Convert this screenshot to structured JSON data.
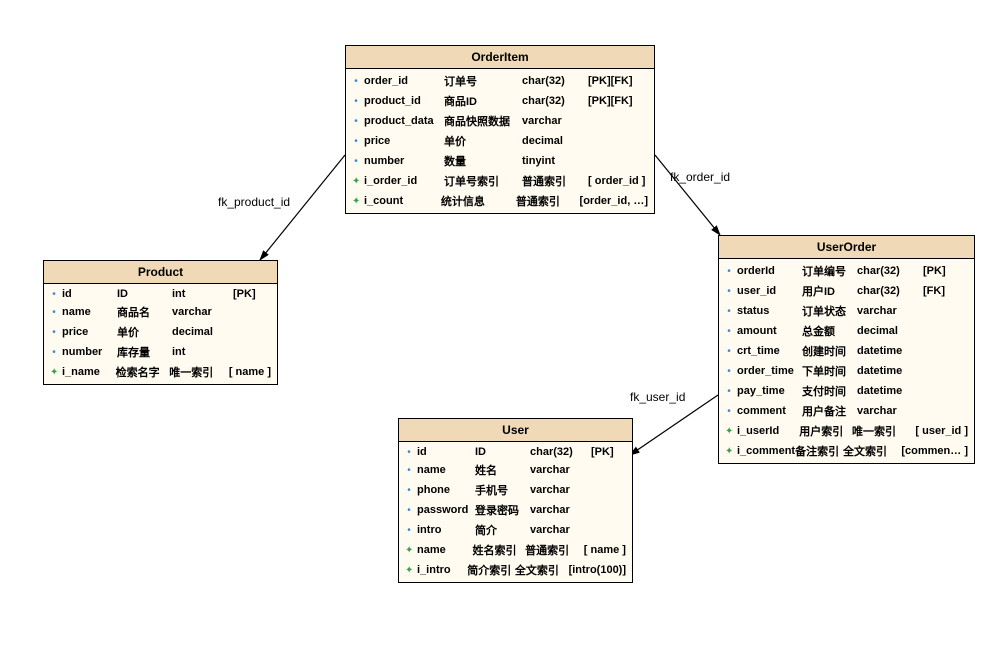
{
  "entities": {
    "orderitem": {
      "title": "OrderItem",
      "rows": [
        {
          "kind": "col",
          "name": "order_id",
          "desc": "订单号",
          "type": "char(32)",
          "flags": "[PK][FK]"
        },
        {
          "kind": "col",
          "name": "product_id",
          "desc": "商品ID",
          "type": "char(32)",
          "flags": "[PK][FK]"
        },
        {
          "kind": "col",
          "name": "product_data",
          "desc": "商品快照数据",
          "type": "varchar",
          "flags": ""
        },
        {
          "kind": "col",
          "name": "price",
          "desc": "单价",
          "type": "decimal",
          "flags": ""
        },
        {
          "kind": "col",
          "name": "number",
          "desc": "数量",
          "type": "tinyint",
          "flags": ""
        },
        {
          "kind": "idx",
          "name": "i_order_id",
          "desc": "订单号索引",
          "type": "普通索引",
          "flags": "[ order_id ]"
        },
        {
          "kind": "idx",
          "name": "i_count",
          "desc": "统计信息",
          "type": "普通索引",
          "flags": "[order_id, …]"
        }
      ]
    },
    "product": {
      "title": "Product",
      "rows": [
        {
          "kind": "col",
          "name": "id",
          "desc": "ID",
          "type": "int",
          "flags": "[PK]"
        },
        {
          "kind": "col",
          "name": "name",
          "desc": "商品名",
          "type": "varchar",
          "flags": ""
        },
        {
          "kind": "col",
          "name": "price",
          "desc": "单价",
          "type": "decimal",
          "flags": ""
        },
        {
          "kind": "col",
          "name": "number",
          "desc": "库存量",
          "type": "int",
          "flags": ""
        },
        {
          "kind": "idx",
          "name": "i_name",
          "desc": "检索名字",
          "type": "唯一索引",
          "flags": "[ name ]"
        }
      ]
    },
    "user": {
      "title": "User",
      "rows": [
        {
          "kind": "col",
          "name": "id",
          "desc": "ID",
          "type": "char(32)",
          "flags": "[PK]"
        },
        {
          "kind": "col",
          "name": "name",
          "desc": "姓名",
          "type": "varchar",
          "flags": ""
        },
        {
          "kind": "col",
          "name": "phone",
          "desc": "手机号",
          "type": "varchar",
          "flags": ""
        },
        {
          "kind": "col",
          "name": "password",
          "desc": "登录密码",
          "type": "varchar",
          "flags": ""
        },
        {
          "kind": "col",
          "name": "intro",
          "desc": "简介",
          "type": "varchar",
          "flags": ""
        },
        {
          "kind": "idx",
          "name": "name",
          "desc": "姓名索引",
          "type": "普通索引",
          "flags": "[ name ]"
        },
        {
          "kind": "idx",
          "name": "i_intro",
          "desc": "简介索引",
          "type": "全文索引",
          "flags": "[intro(100)]"
        }
      ]
    },
    "userorder": {
      "title": "UserOrder",
      "rows": [
        {
          "kind": "col",
          "name": "orderId",
          "desc": "订单编号",
          "type": "char(32)",
          "flags": "[PK]"
        },
        {
          "kind": "col",
          "name": "user_id",
          "desc": "用户ID",
          "type": "char(32)",
          "flags": "[FK]"
        },
        {
          "kind": "col",
          "name": "status",
          "desc": "订单状态",
          "type": "varchar",
          "flags": ""
        },
        {
          "kind": "col",
          "name": "amount",
          "desc": "总金额",
          "type": "decimal",
          "flags": ""
        },
        {
          "kind": "col",
          "name": "crt_time",
          "desc": "创建时间",
          "type": "datetime",
          "flags": ""
        },
        {
          "kind": "col",
          "name": "order_time",
          "desc": "下单时间",
          "type": "datetime",
          "flags": ""
        },
        {
          "kind": "col",
          "name": "pay_time",
          "desc": "支付时间",
          "type": "datetime",
          "flags": ""
        },
        {
          "kind": "col",
          "name": "comment",
          "desc": "用户备注",
          "type": "varchar",
          "flags": ""
        },
        {
          "kind": "idx",
          "name": "i_userId",
          "desc": "用户索引",
          "type": "唯一索引",
          "flags": "[ user_id ]"
        },
        {
          "kind": "idx",
          "name": "i_comment",
          "desc": "备注索引",
          "type": "全文索引",
          "flags": "[commen… ]"
        }
      ]
    }
  },
  "relationships": [
    {
      "label": "fk_product_id",
      "from": "orderitem",
      "to": "product"
    },
    {
      "label": "fk_order_id",
      "from": "orderitem",
      "to": "userorder"
    },
    {
      "label": "fk_user_id",
      "from": "userorder",
      "to": "user"
    }
  ],
  "labels": {
    "fk_product_id": "fk_product_id",
    "fk_order_id": "fk_order_id",
    "fk_user_id": "fk_user_id"
  }
}
